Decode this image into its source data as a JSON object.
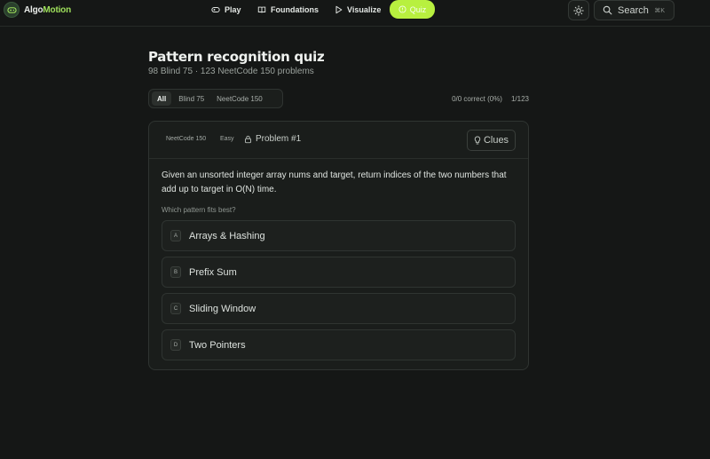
{
  "brand": {
    "part1": "Algo",
    "part2": "Motion"
  },
  "nav": {
    "play": "Play",
    "foundations": "Foundations",
    "visualize": "Visualize",
    "quiz": "Quiz"
  },
  "search": {
    "label": "Search",
    "shortcut": "⌘K"
  },
  "page": {
    "title": "Pattern recognition quiz",
    "subtitle": "98 Blind 75 · 123 NeetCode 150 problems"
  },
  "filters": {
    "tabs": [
      "All",
      "Blind 75",
      "NeetCode 150"
    ],
    "active": "All"
  },
  "stats": {
    "correct": "0/0 correct (0%)",
    "progress": "1/123"
  },
  "card": {
    "tags": [
      "NeetCode 150",
      "Easy"
    ],
    "problem_label": "Problem #1",
    "clues_label": "Clues",
    "question": "Given an unsorted integer array nums and target, return indices of the two numbers that add up to target in O(N) time.",
    "prompt": "Which pattern fits best?",
    "options": [
      {
        "letter": "A",
        "label": "Arrays & Hashing"
      },
      {
        "letter": "B",
        "label": "Prefix Sum"
      },
      {
        "letter": "C",
        "label": "Sliding Window"
      },
      {
        "letter": "D",
        "label": "Two Pointers"
      }
    ]
  },
  "colors": {
    "accent": "#b8f03f",
    "background": "#151716",
    "card": "#1a1d1b",
    "brand_green": "#9fe05c"
  },
  "icons": [
    "gamepad-icon",
    "book-icon",
    "play-icon",
    "quiz-icon",
    "sun-icon",
    "search-icon",
    "lock-icon",
    "lightbulb-icon"
  ]
}
